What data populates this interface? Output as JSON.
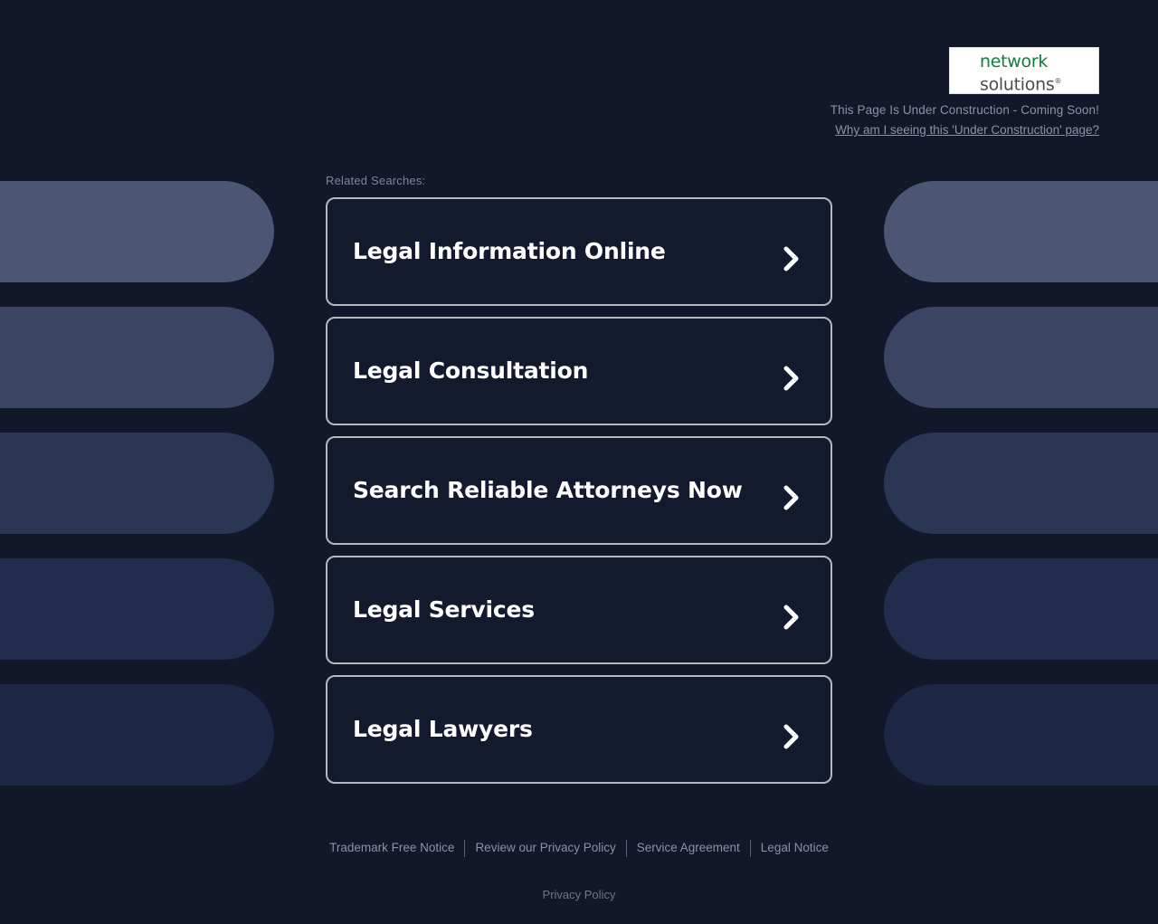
{
  "page": {
    "background_color": "#121729",
    "card_border_color": "#b3b7c0",
    "accent_green": "#147a3d"
  },
  "header": {
    "logo": {
      "line1": "network",
      "line2": "solutions",
      "registered_mark": "®"
    },
    "construction_note": "This Page Is Under Construction - Coming Soon!",
    "construction_link": "Why am I seeing this 'Under Construction' page?"
  },
  "main": {
    "related_label": "Related Searches:",
    "cards": [
      {
        "title": "Legal Information Online",
        "chevron": "chevron-right-icon"
      },
      {
        "title": "Legal Consultation",
        "chevron": "chevron-right-icon"
      },
      {
        "title": "Search Reliable Attorneys Now",
        "chevron": "chevron-right-icon"
      },
      {
        "title": "Legal Services",
        "chevron": "chevron-right-icon"
      },
      {
        "title": "Legal Lawyers",
        "chevron": "chevron-right-icon"
      }
    ]
  },
  "decoration": {
    "pill_colors": [
      "#4c5573",
      "#3b4463",
      "#2b3554",
      "#222c4c",
      "#1d2745"
    ],
    "pill_tops": [
      200,
      339,
      478,
      617,
      756
    ]
  },
  "footer": {
    "links": [
      "Trademark Free Notice",
      "Review our Privacy Policy",
      "Service Agreement",
      "Legal Notice"
    ],
    "privacy_policy": "Privacy Policy"
  }
}
